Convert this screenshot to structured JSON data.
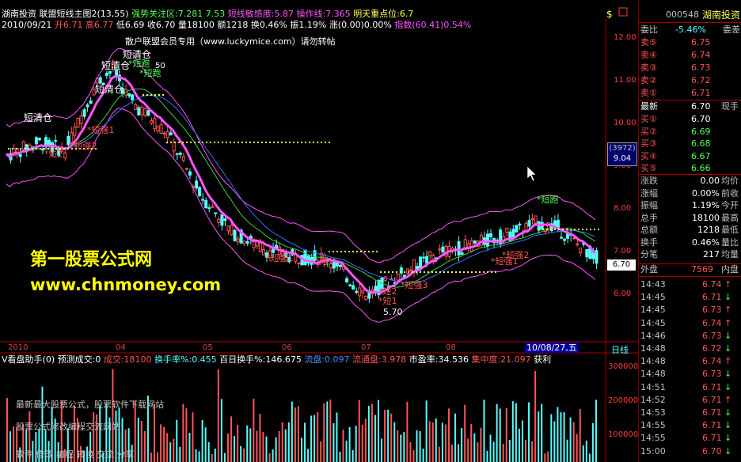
{
  "header": {
    "broker": "湖南投资",
    "indicator_name": "联盟短线主图2",
    "indicator_params": "(13,55)",
    "strong_zone_label": "强势关注区",
    "strong_zone_value": ":7.281",
    "value2": "7.53",
    "sensitivity_label": "短线敏感度",
    "sensitivity_value": ":5.87",
    "op_line_label": "操作线",
    "op_line_value": ":7.365",
    "tomorrow_label": "明天重点位",
    "tomorrow_value": ":6.7"
  },
  "ohlc_line": {
    "date": "2010/09/21",
    "open": "开6.71",
    "high": "高6.77",
    "low": "低6.69",
    "close": "收6.70",
    "volume": "量18100",
    "amount": "额1218",
    "turnover": "换0.46%",
    "amplitude": "振1.19%",
    "change": "涨(0.00)0.00%",
    "index": "指数(60.41)0.54%"
  },
  "watermark_line": "散户联盟会员专用（www.luckymice.com）请勿转帖",
  "promo": {
    "title": "第一股票公式网",
    "url": "www.chnmoney.com"
  },
  "annotations": {
    "clear1": "短清仓",
    "clear2": "短清仓",
    "clear3": "短清仓",
    "clear4": "短清仓",
    "run1": "*短跑",
    "run2": "*短跑",
    "run3": "*短跑",
    "strong1": "*短强1",
    "strong2": "*短强2",
    "strong3": "*短强3",
    "strong4": "*短强2",
    "short1": "*短1",
    "short2": "*短2",
    "buy1": "*短强1",
    "price_low": "5.70",
    "price_59": "50"
  },
  "y_axis": {
    "ticks": [
      "12.00",
      "11.00",
      "10.00",
      "9.00",
      "8.00",
      "7.00",
      "6.00"
    ],
    "cursor_label": "(3972)",
    "cursor_price": "9.04",
    "current_price": "6.70"
  },
  "x_axis": {
    "labels": [
      "2010",
      "04",
      "05",
      "06",
      "07",
      "08"
    ],
    "selected_date": "10/08/27,五",
    "period": "日线"
  },
  "sub_header": {
    "name": "V看盘助手(0)",
    "predict_label": "预测成交:0",
    "deal_label": "成交",
    "deal_value": ":18100",
    "turn_label": "换手率%",
    "turn_value": ":0.455",
    "hundred_label": "百日换手%:146.675",
    "tong_label": "流盘",
    "tong_value": ":0.097",
    "float_label": "流通盘",
    "float_value": ":3.978",
    "pe_label": "市盈率",
    "pe_value": ":34.536",
    "conc_label": "集中度",
    "conc_value": ":21.097",
    "profit_label": "获利"
  },
  "sub_axis": {
    "ticks": [
      "300000",
      "200000",
      "100000"
    ]
  },
  "sub_notes": {
    "line1": "最新最大股票公式，股票软件下载网站",
    "line2": "股票公式修改编程交流网站",
    "line3": "软件 修改 编程 转换 交流 分享"
  },
  "quote": {
    "code": "000548",
    "name": "湖南投资",
    "wei_bi_label": "委比",
    "wei_bi_value": "-5.46%",
    "wei_cha_label": "委差",
    "asks": [
      {
        "label": "卖⑤",
        "price": "6.75"
      },
      {
        "label": "卖④",
        "price": "6.74"
      },
      {
        "label": "卖③",
        "price": "6.73"
      },
      {
        "label": "卖②",
        "price": "6.72"
      },
      {
        "label": "卖①",
        "price": "6.71"
      }
    ],
    "latest_label": "最新",
    "latest_value": "6.70",
    "spot_label": "现手",
    "bids": [
      {
        "label": "买①",
        "price": "6.70"
      },
      {
        "label": "买②",
        "price": "6.69"
      },
      {
        "label": "买③",
        "price": "6.68"
      },
      {
        "label": "买④",
        "price": "6.67"
      },
      {
        "label": "买⑤",
        "price": "6.66"
      }
    ],
    "stats": [
      {
        "label": "涨跌",
        "value": "0.00",
        "extra": "均价",
        "color": "#ffffff"
      },
      {
        "label": "涨幅",
        "value": "0.00%",
        "extra": "前收",
        "color": "#ffffff"
      },
      {
        "label": "振幅",
        "value": "1.19%",
        "extra": "今开",
        "color": "#ffffff"
      },
      {
        "label": "总手",
        "value": "18100",
        "extra": "最高",
        "color": "#ffffff"
      },
      {
        "label": "总额",
        "value": "1218",
        "extra": "最低",
        "color": "#ffffff"
      },
      {
        "label": "换手",
        "value": "0.46%",
        "extra": "量比",
        "color": "#ffffff"
      },
      {
        "label": "分笔",
        "value": "217",
        "extra": "均量",
        "color": "#ffffff"
      }
    ],
    "outer_label": "外盘",
    "outer_value": "7569",
    "inner_label": "内盘",
    "ticks": [
      {
        "time": "14:43",
        "price": "6.74",
        "dir": "↑"
      },
      {
        "time": "14:45",
        "price": "6.71",
        "dir": "↓"
      },
      {
        "time": "14:45",
        "price": "6.73",
        "dir": "↑"
      },
      {
        "time": "14:45",
        "price": "6.74",
        "dir": "↑"
      },
      {
        "time": "14:46",
        "price": "6.73",
        "dir": "↓"
      },
      {
        "time": "14:48",
        "price": "6.72",
        "dir": "↓"
      },
      {
        "time": "14:48",
        "price": "6.74",
        "dir": "↑"
      },
      {
        "time": "14:48",
        "price": "6.73",
        "dir": "↓"
      },
      {
        "time": "14:51",
        "price": "6.71",
        "dir": "↓"
      },
      {
        "time": "14:52",
        "price": "6.71",
        "dir": "↑"
      },
      {
        "time": "14:53",
        "price": "6.71",
        "dir": "↓"
      },
      {
        "time": "14:55",
        "price": "6.71",
        "dir": "↓"
      },
      {
        "time": "14:55",
        "price": "6.71",
        "dir": "↓"
      },
      {
        "time": "15:00",
        "price": "6.70",
        "dir": "↓"
      }
    ]
  },
  "colors": {
    "up": "#ff5454",
    "down": "#54ffff",
    "axis": "#b00000",
    "ma_fast": "#ff3c3c",
    "ma_mag": "#ff54ff",
    "ma_blue": "#3c6cff",
    "ma_green": "#40d040"
  }
}
